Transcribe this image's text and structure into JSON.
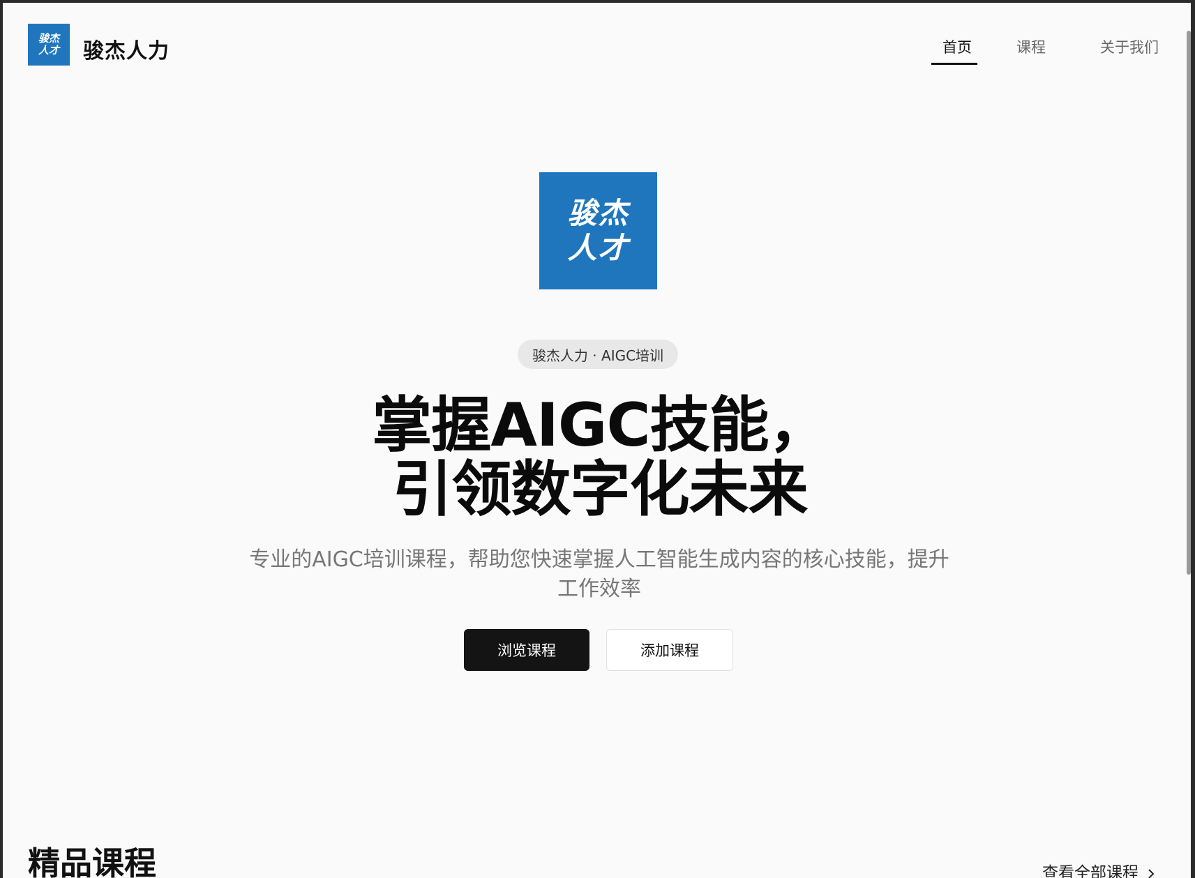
{
  "header": {
    "logo_line1": "骏杰",
    "logo_line2": "人才",
    "brand": "骏杰人力",
    "nav": [
      {
        "label": "首页"
      },
      {
        "label": "课程"
      },
      {
        "label": "关于我们"
      }
    ],
    "active_nav": "首页"
  },
  "hero": {
    "logo_line1": "骏杰",
    "logo_line2": "人才",
    "badge": "骏杰人力 · AIGC培训",
    "headline_line1": "掌握AIGC技能，",
    "headline_line2": "引领数字化未来",
    "subtitle_line1": "专业的AIGC培训课程，帮助您快速掌握人工智能生成内容的核心技能，提升",
    "subtitle_line2": "工作效率",
    "primary_button": "浏览课程",
    "secondary_button": "添加课程"
  },
  "featured": {
    "title": "精品课程",
    "view_all": "查看全部课程"
  },
  "colors": {
    "brand_blue": "#1f76bd",
    "primary_button": "#141414",
    "background": "#fafafa"
  },
  "icons": {
    "view_all_icon": "chevron-right-icon"
  }
}
